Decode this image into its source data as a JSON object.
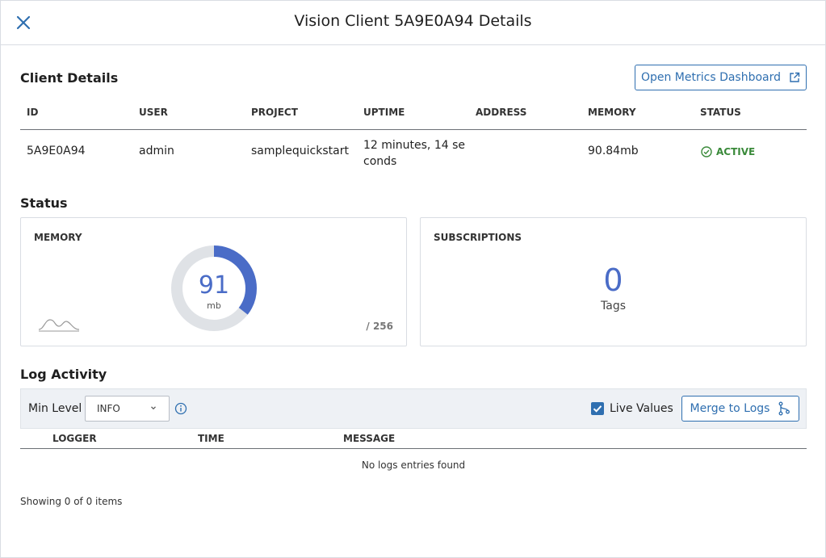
{
  "dialog": {
    "title": "Vision Client 5A9E0A94 Details",
    "close_icon": "close-icon"
  },
  "client_details": {
    "section_title": "Client Details",
    "metrics_button_label": "Open Metrics Dashboard",
    "columns": [
      "ID",
      "USER",
      "PROJECT",
      "UPTIME",
      "ADDRESS",
      "MEMORY",
      "STATUS"
    ],
    "row": {
      "id": "5A9E0A94",
      "user": "admin",
      "project": "samplequickstart",
      "uptime": "12 minutes, 14 seconds",
      "address": "",
      "memory": "90.84mb",
      "status": "ACTIVE"
    }
  },
  "status": {
    "section_title": "Status",
    "memory": {
      "title": "MEMORY",
      "value": "91",
      "unit": "mb",
      "limit": "/ 256",
      "fraction": 0.355
    },
    "subscriptions": {
      "title": "SUBSCRIPTIONS",
      "value": "0",
      "label": "Tags"
    }
  },
  "log_activity": {
    "section_title": "Log Activity",
    "min_level_label": "Min Level",
    "min_level_value": "INFO",
    "live_values_label": "Live Values",
    "live_values_checked": true,
    "merge_button_label": "Merge to Logs",
    "columns": [
      "LOGGER",
      "TIME",
      "MESSAGE"
    ],
    "empty_message": "No logs entries found",
    "showing": "Showing 0 of 0 items"
  },
  "colors": {
    "accent": "#2f6fb0",
    "donut_fill": "#4a6cc7",
    "donut_track": "#dfe2e6",
    "active": "#3a8a3a"
  }
}
